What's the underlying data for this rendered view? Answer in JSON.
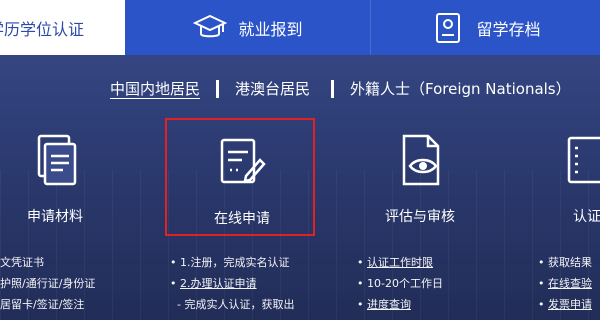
{
  "tabs": {
    "active_label": "学历学位认证",
    "employment_label": "就业报到",
    "archives_label": "留学存档"
  },
  "residency": {
    "options": [
      "中国内地居民",
      "港澳台居民",
      "外籍人士（Foreign Nationals）"
    ],
    "selected": "中国内地居民"
  },
  "steps": [
    {
      "label": "申请材料",
      "icon": "documents-icon"
    },
    {
      "label": "在线申请",
      "icon": "form-edit-icon"
    },
    {
      "label": "评估与审核",
      "icon": "document-eye-icon"
    },
    {
      "label": "认证",
      "icon": "list-icon"
    }
  ],
  "lists": {
    "materials": [
      "文凭证书",
      "护照/通行证/身份证",
      "居留卡/签证/签注"
    ],
    "apply": [
      "1.注册，完成实名认证",
      "2.办理认证申请",
      "- 完成实人认证，获取出"
    ],
    "review": [
      "认证工作时限",
      "10-20个工作日",
      "进度查询"
    ],
    "result": [
      "获取结果",
      "在线查验",
      "发票申请"
    ]
  },
  "colors": {
    "tab_bar_blue": "#2b54c9",
    "page_bg": "#33457f",
    "highlight_border": "#e02222",
    "active_tab_text": "#2c4aa6"
  }
}
